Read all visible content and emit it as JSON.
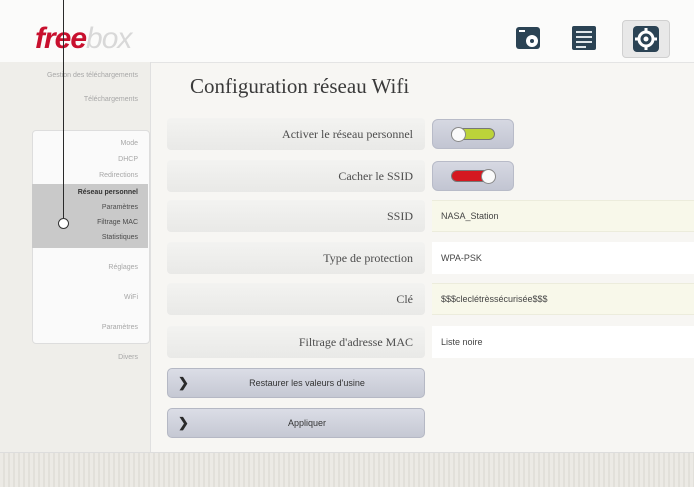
{
  "header": {
    "logo_part1": "free",
    "logo_part2": "box",
    "icons": [
      "disk-icon",
      "list-icon",
      "gear-icon"
    ]
  },
  "sidebar": {
    "items_top": [
      "Gestion des téléchargements",
      "Téléchargements"
    ],
    "items_group_top": [
      "Mode",
      "DHCP",
      "Redirections"
    ],
    "active": [
      "Réseau personnel",
      "Paramètres",
      "Filtrage MAC",
      "Statistiques"
    ],
    "items_group_bottom": [
      "Réglages"
    ],
    "items_bottom": [
      "WiFi",
      "Paramètres",
      "Divers"
    ]
  },
  "page": {
    "title": "Configuration réseau Wifi"
  },
  "settings": [
    {
      "label": "Activer le réseau personnel",
      "type": "toggle",
      "state": "on"
    },
    {
      "label": "Cacher le SSID",
      "type": "toggle",
      "state": "off"
    },
    {
      "label": "SSID",
      "type": "input",
      "value": "NASA_Station"
    },
    {
      "label": "Type de protection",
      "type": "select",
      "value": "WPA-PSK"
    },
    {
      "label": "Clé",
      "type": "input",
      "value": "$$$cleclétrèssécurisée$$$"
    },
    {
      "label": "Filtrage d'adresse MAC",
      "type": "select",
      "value": "Liste noire"
    }
  ],
  "buttons": {
    "restore": "Restaurer les valeurs d'usine",
    "apply": "Appliquer"
  },
  "colors": {
    "brand_red": "#c8102e",
    "toggle_on": "#bcd33a",
    "toggle_off": "#d41820"
  }
}
